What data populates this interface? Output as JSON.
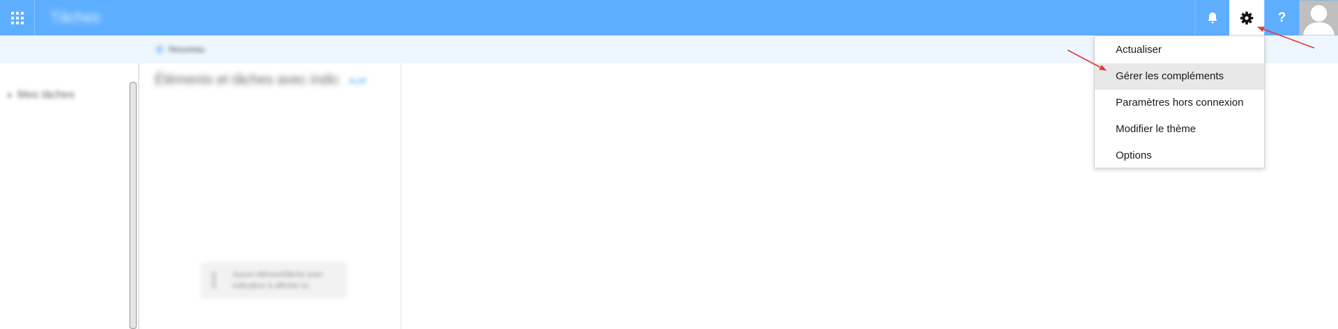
{
  "header": {
    "app_title": "Tâches",
    "waffle_icon": "app-launcher-icon",
    "notifications_icon": "bell-icon",
    "settings_icon": "gear-icon",
    "help_label": "?",
    "avatar_icon": "user-avatar-icon",
    "bar_color": "#5eaeff"
  },
  "toolbar": {
    "new_label": "Nouveau",
    "new_icon": "plus-icon"
  },
  "folders": {
    "items": [
      {
        "label": "Mes tâches",
        "icon": "chevron-right-icon"
      }
    ]
  },
  "list": {
    "header": "Éléments et tâches avec indic",
    "filter_label": "Actif",
    "empty_text": "Aucun élément/tâche avec indicateur à afficher ici."
  },
  "settings_menu": {
    "items": [
      {
        "label": "Actualiser"
      },
      {
        "label": "Gérer les compléments",
        "highlighted": true
      },
      {
        "label": "Paramètres hors connexion"
      },
      {
        "label": "Modifier le thème"
      },
      {
        "label": "Options"
      }
    ],
    "hover_color": "#e8e8e8"
  },
  "annotations": {
    "arrow_color": "#e53935"
  }
}
